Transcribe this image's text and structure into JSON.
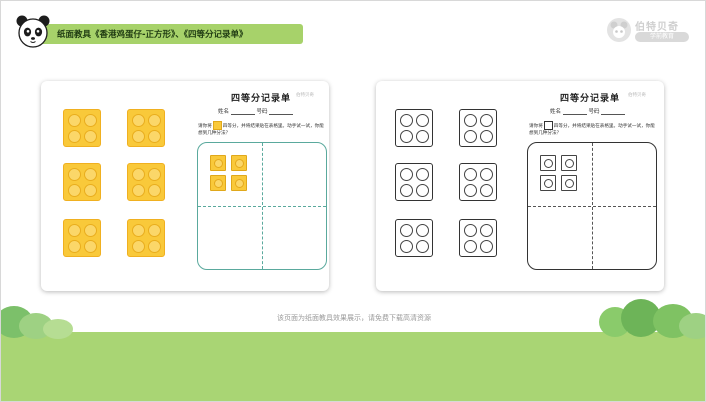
{
  "header": {
    "title": "纸面教具《香港鸡蛋仔-正方形》、《四等分记录单》"
  },
  "brand": {
    "name": "伯特贝奇",
    "sub": "学前教育"
  },
  "worksheet": {
    "title": "四等分记录单",
    "logo_text": "伯特贝奇",
    "name_label": "姓名",
    "number_label": "号码",
    "instruction_prefix": "请你将",
    "instruction_suffix": "四等分，并将结果贴在表格里。动手试一试，你能想到几种分法？"
  },
  "caption": "该页面为纸面教具效果展示，请免费下载高清资源",
  "colors": {
    "header_green": "#a7d26a",
    "piece_yellow": "#f9c93a",
    "quad_teal": "#5aa99d",
    "ground_green": "#a9d574"
  }
}
